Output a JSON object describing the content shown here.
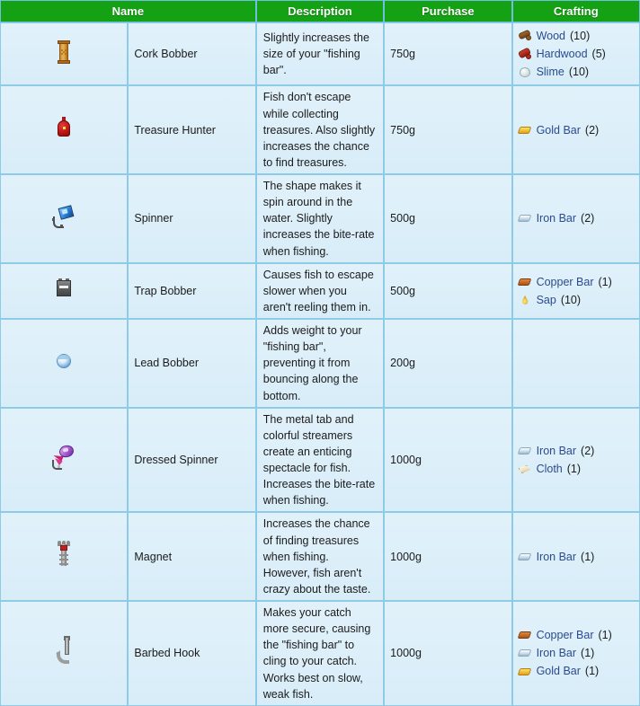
{
  "table": {
    "headers": [
      "Name",
      "Description",
      "Purchase",
      "Crafting"
    ],
    "rows": [
      {
        "icon": "cork-bobber-sprite",
        "name": "Cork Bobber",
        "description": "Slightly increases the size of your \"fishing bar\".",
        "purchase": "750g",
        "crafting": [
          {
            "icon": "wood-icon",
            "material": "Wood",
            "qty": "(10)"
          },
          {
            "icon": "hardwood-icon",
            "material": "Hardwood",
            "qty": "(5)"
          },
          {
            "icon": "slime-icon",
            "material": "Slime",
            "qty": "(10)"
          }
        ]
      },
      {
        "icon": "treasure-hunter-sprite",
        "name": "Treasure Hunter",
        "description": "Fish don't escape while collecting treasures. Also slightly increases the chance to find treasures.",
        "purchase": "750g",
        "crafting": [
          {
            "icon": "gold-bar-icon",
            "material": "Gold Bar",
            "qty": "(2)"
          }
        ]
      },
      {
        "icon": "spinner-sprite",
        "name": "Spinner",
        "description": "The shape makes it spin around in the water. Slightly increases the bite-rate when fishing.",
        "purchase": "500g",
        "crafting": [
          {
            "icon": "iron-bar-icon",
            "material": "Iron Bar",
            "qty": "(2)"
          }
        ]
      },
      {
        "icon": "trap-bobber-sprite",
        "name": "Trap Bobber",
        "description": "Causes fish to escape slower when you aren't reeling them in.",
        "purchase": "500g",
        "crafting": [
          {
            "icon": "copper-bar-icon",
            "material": "Copper Bar",
            "qty": "(1)"
          },
          {
            "icon": "sap-icon",
            "material": "Sap",
            "qty": "(10)"
          }
        ]
      },
      {
        "icon": "lead-bobber-sprite",
        "name": "Lead Bobber",
        "description": "Adds weight to your \"fishing bar\", preventing it from bouncing along the bottom.",
        "purchase": "200g",
        "crafting": []
      },
      {
        "icon": "dressed-spinner-sprite",
        "name": "Dressed Spinner",
        "description": "The metal tab and colorful streamers create an enticing spectacle for fish. Increases the bite-rate when fishing.",
        "purchase": "1000g",
        "crafting": [
          {
            "icon": "iron-bar-icon",
            "material": "Iron Bar",
            "qty": "(2)"
          },
          {
            "icon": "cloth-icon",
            "material": "Cloth",
            "qty": "(1)"
          }
        ]
      },
      {
        "icon": "magnet-sprite",
        "name": "Magnet",
        "description": "Increases the chance of finding treasures when fishing. However, fish aren't crazy about the taste.",
        "purchase": "1000g",
        "crafting": [
          {
            "icon": "iron-bar-icon",
            "material": "Iron Bar",
            "qty": "(1)"
          }
        ]
      },
      {
        "icon": "barbed-hook-sprite",
        "name": "Barbed Hook",
        "description": "Makes your catch more secure, causing the \"fishing bar\" to cling to your catch. Works best on slow, weak fish.",
        "purchase": "1000g",
        "crafting": [
          {
            "icon": "copper-bar-icon",
            "material": "Copper Bar",
            "qty": "(1)"
          },
          {
            "icon": "iron-bar-icon",
            "material": "Iron Bar",
            "qty": "(1)"
          },
          {
            "icon": "gold-bar-icon",
            "material": "Gold Bar",
            "qty": "(1)"
          }
        ]
      }
    ]
  },
  "colors": {
    "header_green": "#14a114",
    "cell_blue": "#d6ecf8",
    "border_blue": "#8ecbe6",
    "link_blue": "#2b4b8f"
  }
}
